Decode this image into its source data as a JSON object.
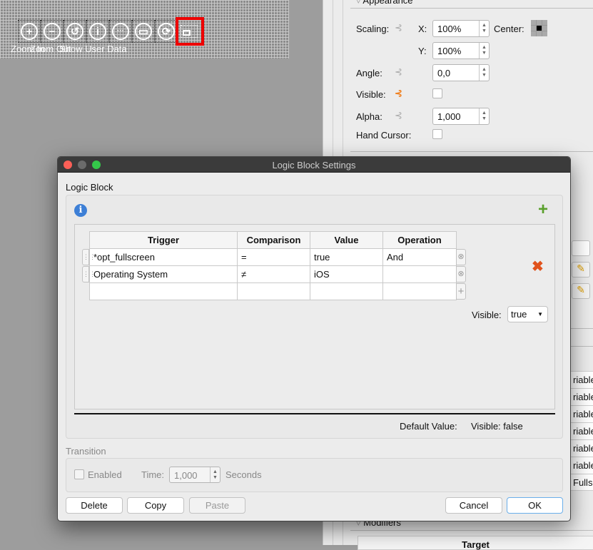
{
  "toolbar": {
    "items": [
      {
        "icon": "zoom-in-icon",
        "glyph": "+"
      },
      {
        "icon": "zoom-out-icon",
        "glyph": "−"
      },
      {
        "icon": "reset-icon",
        "glyph": "↺"
      },
      {
        "icon": "info-icon",
        "glyph": "i"
      },
      {
        "icon": "more-icon",
        "glyph": "···"
      },
      {
        "icon": "fit-icon",
        "glyph": "▭"
      },
      {
        "icon": "refresh-icon",
        "glyph": "⟳"
      },
      {
        "icon": "user-data-icon",
        "glyph": "▭"
      }
    ],
    "labels": [
      "Zoom In",
      "Zoom Out",
      "Show User Data"
    ],
    "highlight_color": "#e00000"
  },
  "panel": {
    "section_appearance": "Appearance",
    "scaling_label": "Scaling:",
    "x_label": "X:",
    "x_value": "100%",
    "center_label": "Center:",
    "y_label": "Y:",
    "y_value": "100%",
    "angle_label": "Angle:",
    "angle_value": "0,0",
    "visible_label": "Visible:",
    "alpha_label": "Alpha:",
    "alpha_value": "1,000",
    "hand_cursor_label": "Hand Cursor:",
    "rows": [
      "riable",
      "riable",
      "riable",
      "riable",
      "riable",
      "riable",
      "Fulls"
    ],
    "section_modifiers": "Modifiers",
    "target_header": "Target",
    "logic_link_color": "#f08020"
  },
  "dialog": {
    "title": "Logic Block Settings",
    "logic_block_label": "Logic Block",
    "table": {
      "headers": [
        "Trigger",
        "Comparison",
        "Value",
        "Operation"
      ],
      "rows": [
        [
          "*opt_fullscreen",
          "=",
          "true",
          "And"
        ],
        [
          "Operating System",
          "≠",
          "iOS",
          ""
        ],
        [
          "",
          "",
          "",
          ""
        ]
      ]
    },
    "visible_label": "Visible:",
    "visible_value": "true",
    "default_value_label": "Default Value:",
    "default_visible": "Visible:  false",
    "transition_label": "Transition",
    "enabled_label": "Enabled",
    "time_label": "Time:",
    "time_value": "1,000",
    "seconds_label": "Seconds",
    "buttons": {
      "delete": "Delete",
      "copy": "Copy",
      "paste": "Paste",
      "cancel": "Cancel",
      "ok": "OK"
    }
  }
}
